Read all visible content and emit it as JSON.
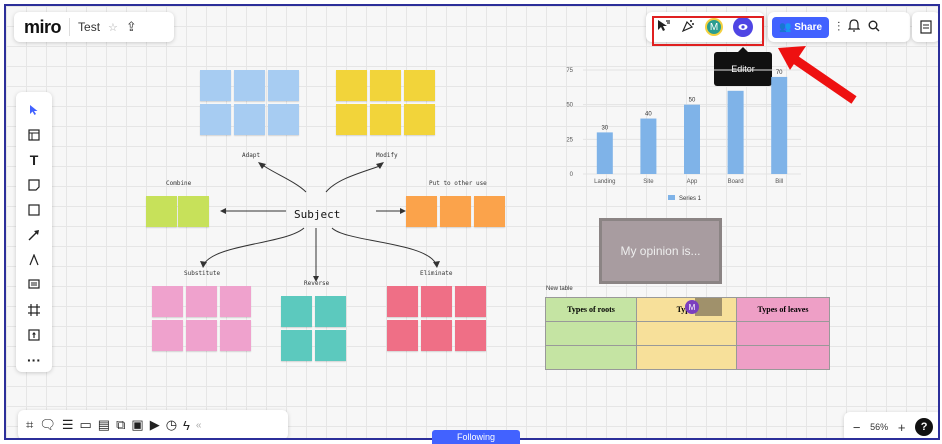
{
  "header": {
    "logo": "miro",
    "board_name": "Test",
    "star_icon": "star-icon",
    "upload_icon": "upload-icon"
  },
  "collab": {
    "avatar_initial": "M",
    "tooltip": "Editor"
  },
  "share": {
    "label": "Share"
  },
  "canvas": {
    "subject": "Subject",
    "labels": {
      "adapt": "Adapt",
      "modify": "Modify",
      "combine": "Combine",
      "put_to_other_use": "Put to other use",
      "substitute": "Substitute",
      "reverse": "Reverse",
      "eliminate": "Eliminate"
    },
    "colors": {
      "blue": "#a7ccf2",
      "yellow": "#f2d43a",
      "green": "#c7e15a",
      "orange": "#fba34b",
      "pink": "#efa2cd",
      "teal": "#5cc9be",
      "red": "#ef6f86"
    },
    "opinion_text": "My opinion is...",
    "new_table_label": "New table",
    "table_headers": [
      "Types of roots",
      "Types",
      "Types of leaves"
    ],
    "table_colors": [
      "#c5e4a3",
      "#f7e09a",
      "#ee9fc6"
    ],
    "table_avatar": "M"
  },
  "chart_data": {
    "type": "bar",
    "categories": [
      "Landing",
      "Site",
      "App",
      "Board",
      "Bill"
    ],
    "values": [
      30,
      40,
      50,
      60,
      70
    ],
    "data_labels": [
      "30",
      "40",
      "50",
      "",
      "70"
    ],
    "yticks": [
      0,
      25,
      50,
      75
    ],
    "ylim": [
      0,
      75
    ],
    "series_name": "Series 1",
    "bar_color": "#7fb3e8"
  },
  "zoom": {
    "level": "56%",
    "minus": "−",
    "plus": "+",
    "help": "?"
  },
  "following": "Following"
}
